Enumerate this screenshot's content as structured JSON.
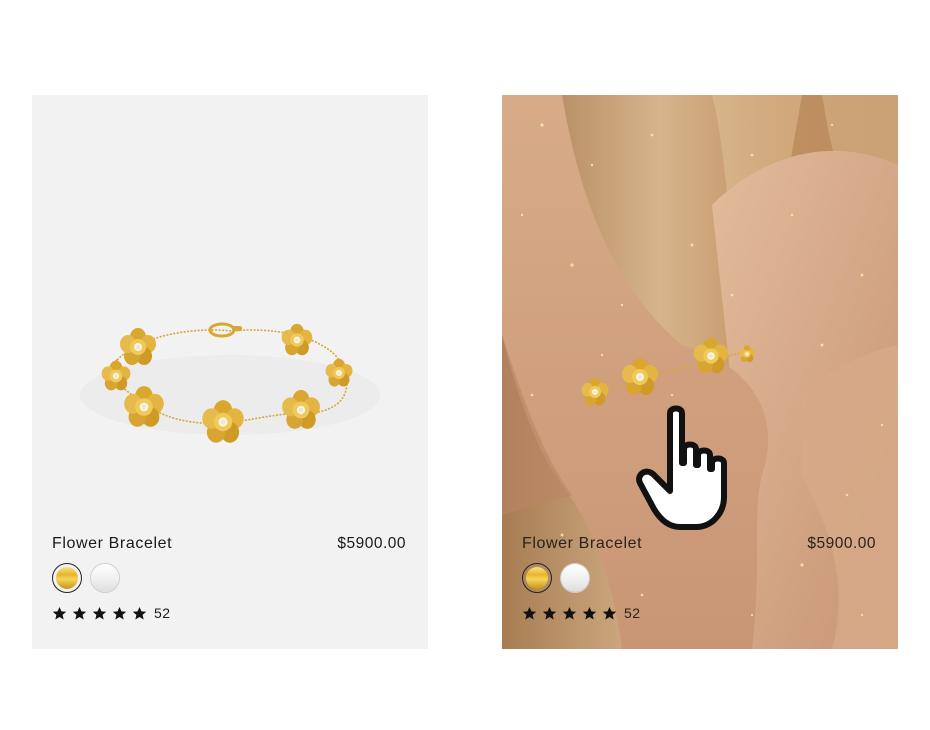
{
  "products": [
    {
      "name": "Flower Bracelet",
      "price": "$5900.00",
      "swatches": [
        "gold",
        "silver"
      ],
      "selected_swatch": "gold",
      "rating_stars": 5,
      "review_count": "52"
    },
    {
      "name": "Flower Bracelet",
      "price": "$5900.00",
      "swatches": [
        "gold",
        "silver"
      ],
      "selected_swatch": "gold",
      "rating_stars": 5,
      "review_count": "52"
    }
  ],
  "cursor": {
    "icon": "pointing-hand-icon"
  },
  "colors": {
    "gold": "#e6b42c",
    "card_bg": "#f2f2f2",
    "text": "#1a1a1a"
  }
}
